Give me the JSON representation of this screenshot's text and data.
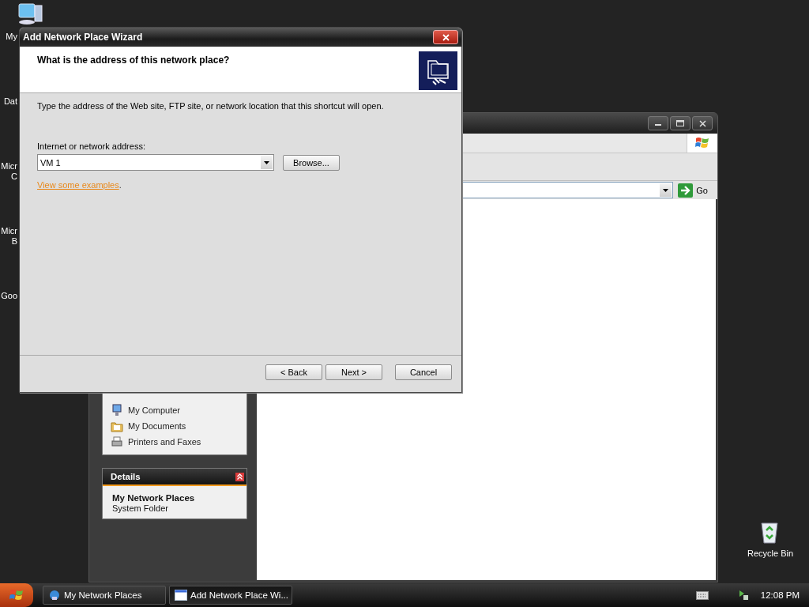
{
  "desktop": {
    "icons": [
      {
        "label_lines": [
          "My"
        ]
      },
      {
        "label_lines": [
          "Dat"
        ]
      },
      {
        "label_lines": [
          "Micr",
          "C"
        ]
      },
      {
        "label_lines": [
          "Micr",
          "B"
        ]
      },
      {
        "label_lines": [
          "Goo"
        ]
      }
    ],
    "recycle_bin": {
      "label": "Recycle Bin"
    }
  },
  "explorer_window": {
    "address": {
      "go_label": "Go"
    },
    "other_places": {
      "items": [
        {
          "label": "My Computer",
          "kind": "computer"
        },
        {
          "label": "My Documents",
          "kind": "documents"
        },
        {
          "label": "Printers and Faxes",
          "kind": "printer"
        }
      ]
    },
    "details": {
      "title": "Details",
      "name": "My Network Places",
      "type": "System Folder"
    }
  },
  "wizard": {
    "title": "Add Network Place Wizard",
    "heading": "What is the address of this network place?",
    "instruction": "Type the address of the Web site, FTP site, or network location that this shortcut will open.",
    "address_label": "Internet or network address:",
    "address_value": "VM 1",
    "browse_button": "Browse...",
    "examples_link": "View some examples",
    "examples_suffix": ".",
    "buttons": [
      {
        "label": "< Back",
        "kind": "nav"
      },
      {
        "label": "Next >",
        "kind": "nav"
      },
      {
        "label": "Cancel",
        "kind": "cancel"
      }
    ]
  },
  "taskbar": {
    "tasks": [
      {
        "label": "My Network Places",
        "kind": "folder",
        "selected": false
      },
      {
        "label": "Add Network Place Wi...",
        "kind": "window",
        "selected": true
      }
    ],
    "clock": "12:08 PM"
  }
}
